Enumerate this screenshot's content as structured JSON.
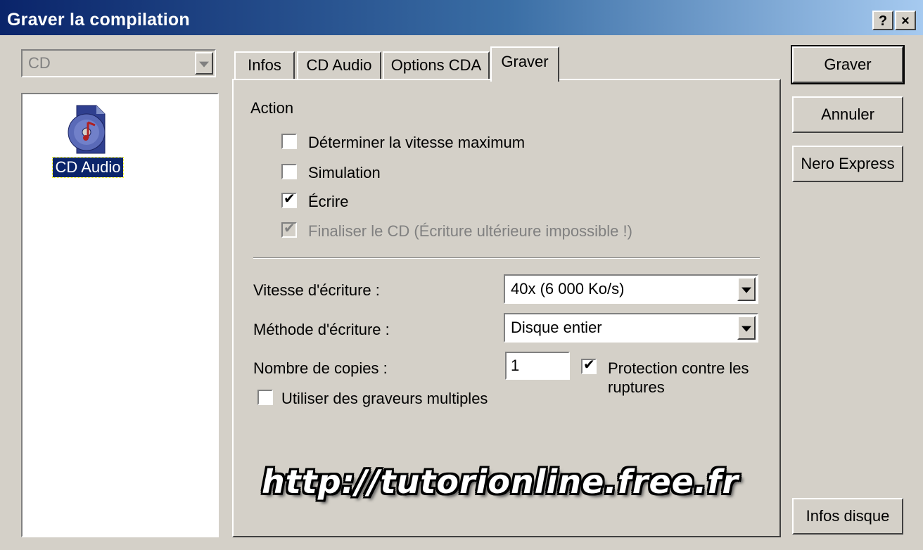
{
  "window": {
    "title": "Graver la compilation",
    "help_label": "?",
    "close_label": "×"
  },
  "media_select": {
    "value": "CD"
  },
  "compilation_list": [
    {
      "label": "CD Audio",
      "icon": "cd-audio-icon"
    }
  ],
  "tabs": [
    {
      "label": "Infos"
    },
    {
      "label": "CD Audio"
    },
    {
      "label": "Options CDA"
    },
    {
      "label": "Graver",
      "active": true
    }
  ],
  "burn_tab": {
    "action_heading": "Action",
    "options": [
      {
        "label": "Déterminer la vitesse maximum",
        "checked": false,
        "enabled": true
      },
      {
        "label": "Simulation",
        "checked": false,
        "enabled": true
      },
      {
        "label": "Écrire",
        "checked": true,
        "enabled": true
      },
      {
        "label": "Finaliser le CD (Écriture ultérieure impossible !)",
        "checked": true,
        "enabled": false
      }
    ],
    "write_speed_label": "Vitesse d'écriture :",
    "write_speed_value": "40x (6 000 Ko/s)",
    "write_method_label": "Méthode d'écriture :",
    "write_method_value": "Disque entier",
    "copies_label": "Nombre de copies :",
    "copies_value": "1",
    "buffer_protection": {
      "label_line1": "Protection contre les",
      "label_line2": "ruptures",
      "checked": true
    },
    "multiple_recorders": {
      "label": "Utiliser des graveurs multiples",
      "checked": false
    }
  },
  "buttons": {
    "burn": "Graver",
    "cancel": "Annuler",
    "nero_express": "Nero Express",
    "disc_info": "Infos disque"
  },
  "watermark": "http://tutorionline.free.fr",
  "check_mark": "✔"
}
